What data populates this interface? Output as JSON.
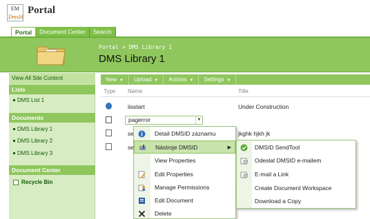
{
  "header": {
    "logo_em": "EM",
    "logo_dms": "DmsId",
    "title": "Portal"
  },
  "tabs": [
    {
      "label": "Portal"
    },
    {
      "label": "Document Center"
    },
    {
      "label": "Search"
    }
  ],
  "breadcrumb": "Portal > DMS Library 1",
  "page_title": "DMS Library 1",
  "leftnav": {
    "view_all": "View All Site Content",
    "lists_head": "Lists",
    "lists": [
      "DMS List 1"
    ],
    "documents_head": "Documents",
    "documents": [
      "DMS Library 1",
      "DMS Library 2",
      "DMS Library 3"
    ],
    "doc_center_head": "Document Center",
    "recycle_bin": "Recycle Bin"
  },
  "toolbar": {
    "new": "New",
    "upload": "Upload",
    "actions": "Actions",
    "settings": "Settings"
  },
  "columns": {
    "type": "Type",
    "name": "Name",
    "title": "Title"
  },
  "rows": [
    {
      "name": "iisstart",
      "title": "Under Construction"
    },
    {
      "name": "pagerror",
      "title": ""
    },
    {
      "name": "se",
      "title": "jkghk hjkh jk"
    },
    {
      "name": "se",
      "title": ""
    }
  ],
  "menu": [
    {
      "label": "Detail DMSID záznamu",
      "icon": "info-icon"
    },
    {
      "label": "Nástroje DMSID",
      "icon": "tools-icon"
    },
    {
      "label": "View Properties",
      "icon": ""
    },
    {
      "label": "Edit Properties",
      "icon": "edit-properties-icon"
    },
    {
      "label": "Manage Permissions",
      "icon": "permissions-icon"
    },
    {
      "label": "Edit Document",
      "icon": "edit-document-icon"
    },
    {
      "label": "Delete",
      "icon": "delete-icon"
    }
  ],
  "submenu": [
    {
      "label": "DMSID SendTool",
      "icon": "sendtool-icon"
    },
    {
      "label": "Odeslat DMSID e-mailem",
      "icon": "email-icon"
    },
    {
      "label": "E-mail a Link",
      "icon": "email-link-icon"
    },
    {
      "label": "Create Document Workspace",
      "icon": ""
    },
    {
      "label": "Download a Copy",
      "icon": ""
    }
  ]
}
